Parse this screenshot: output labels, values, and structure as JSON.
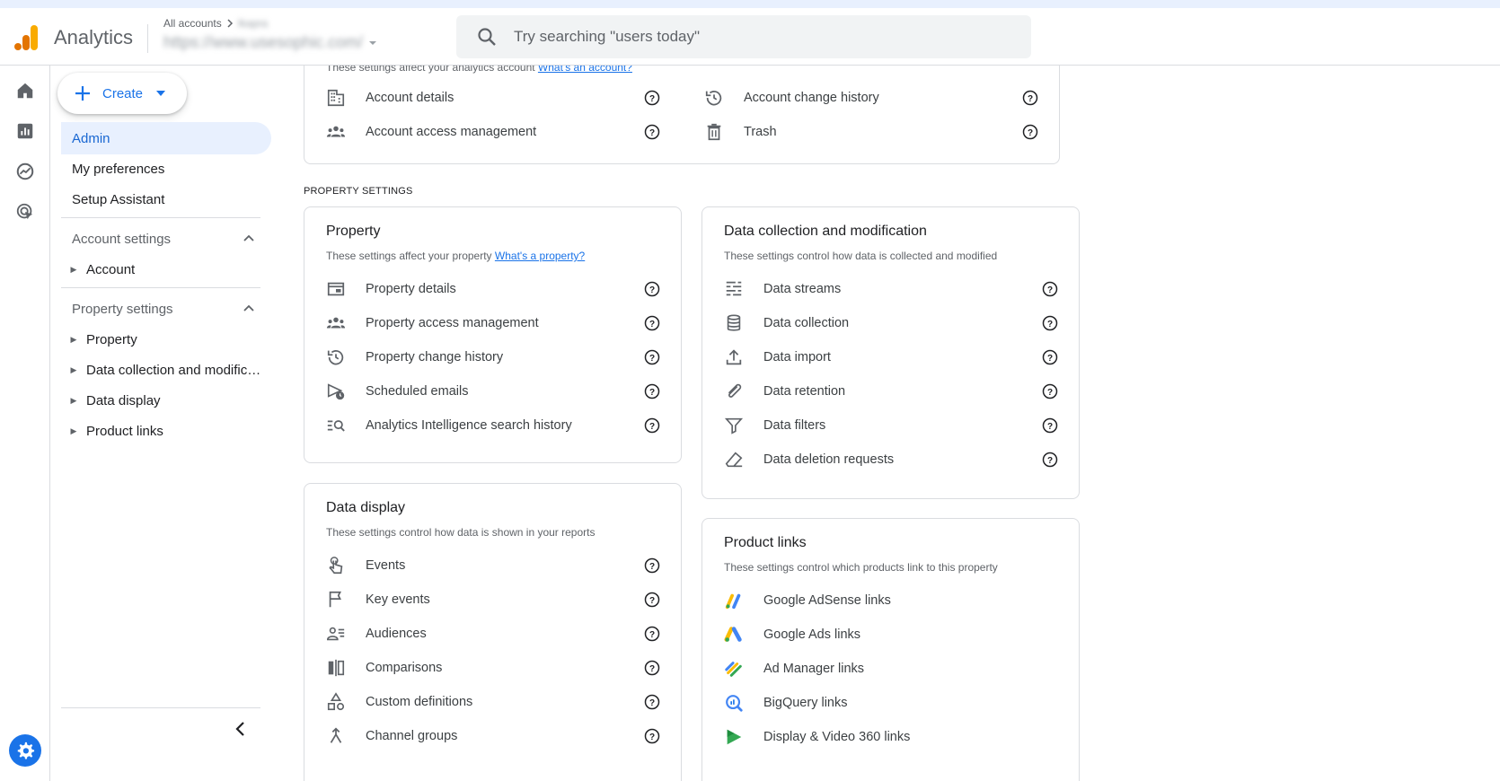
{
  "header": {
    "app_title": "Analytics",
    "breadcrumb_all": "All accounts",
    "breadcrumb_account": "Ikapra",
    "account_url": "https://www.usesophic.com/",
    "search_placeholder": "Try searching \"users today\""
  },
  "rail": [
    "home-icon",
    "reports-icon",
    "explore-icon",
    "advertising-icon",
    "admin-gear-icon"
  ],
  "sidenav": {
    "create_label": "Create",
    "items": [
      "Admin",
      "My preferences",
      "Setup Assistant"
    ],
    "account_group": "Account settings",
    "account_children": [
      "Account"
    ],
    "property_group": "Property settings",
    "property_children": [
      "Property",
      "Data collection and modifica...",
      "Data display",
      "Product links"
    ]
  },
  "account_card": {
    "desc": "These settings affect your analytics account",
    "desc_link": "What's an account?",
    "left": [
      {
        "label": "Account details",
        "icon": "building-icon"
      },
      {
        "label": "Account access management",
        "icon": "people-icon"
      }
    ],
    "right": [
      {
        "label": "Account change history",
        "icon": "history-icon"
      },
      {
        "label": "Trash",
        "icon": "trash-icon"
      }
    ]
  },
  "property_section_label": "PROPERTY SETTINGS",
  "property_card": {
    "title": "Property",
    "desc": "These settings affect your property",
    "desc_link": "What's a property?",
    "rows": [
      {
        "label": "Property details",
        "icon": "property-details-icon"
      },
      {
        "label": "Property access management",
        "icon": "people-icon"
      },
      {
        "label": "Property change history",
        "icon": "history-icon"
      },
      {
        "label": "Scheduled emails",
        "icon": "scheduled-email-icon"
      },
      {
        "label": "Analytics Intelligence search history",
        "icon": "search-history-icon"
      }
    ]
  },
  "data_collection_card": {
    "title": "Data collection and modification",
    "desc": "These settings control how data is collected and modified",
    "rows": [
      {
        "label": "Data streams",
        "icon": "streams-icon"
      },
      {
        "label": "Data collection",
        "icon": "database-icon"
      },
      {
        "label": "Data import",
        "icon": "upload-icon"
      },
      {
        "label": "Data retention",
        "icon": "paperclip-icon"
      },
      {
        "label": "Data filters",
        "icon": "filter-icon"
      },
      {
        "label": "Data deletion requests",
        "icon": "eraser-icon"
      }
    ]
  },
  "data_display_card": {
    "title": "Data display",
    "desc": "These settings control how data is shown in your reports",
    "rows": [
      {
        "label": "Events",
        "icon": "touch-icon"
      },
      {
        "label": "Key events",
        "icon": "flag-icon"
      },
      {
        "label": "Audiences",
        "icon": "audience-icon"
      },
      {
        "label": "Comparisons",
        "icon": "comparisons-icon"
      },
      {
        "label": "Custom definitions",
        "icon": "shapes-icon"
      },
      {
        "label": "Channel groups",
        "icon": "merge-icon"
      }
    ]
  },
  "product_links_card": {
    "title": "Product links",
    "desc": "These settings control which products link to this property",
    "rows": [
      {
        "label": "Google AdSense links",
        "icon": "adsense-icon"
      },
      {
        "label": "Google Ads links",
        "icon": "google-ads-icon"
      },
      {
        "label": "Ad Manager links",
        "icon": "ad-manager-icon"
      },
      {
        "label": "BigQuery links",
        "icon": "bigquery-icon"
      },
      {
        "label": "Display & Video 360 links",
        "icon": "dv360-icon"
      }
    ]
  },
  "colors": {
    "accent": "#1a73e8",
    "active_bg": "#e8f0fe",
    "logo_orange": "#f9ab00",
    "logo_dark_orange": "#e37400"
  }
}
